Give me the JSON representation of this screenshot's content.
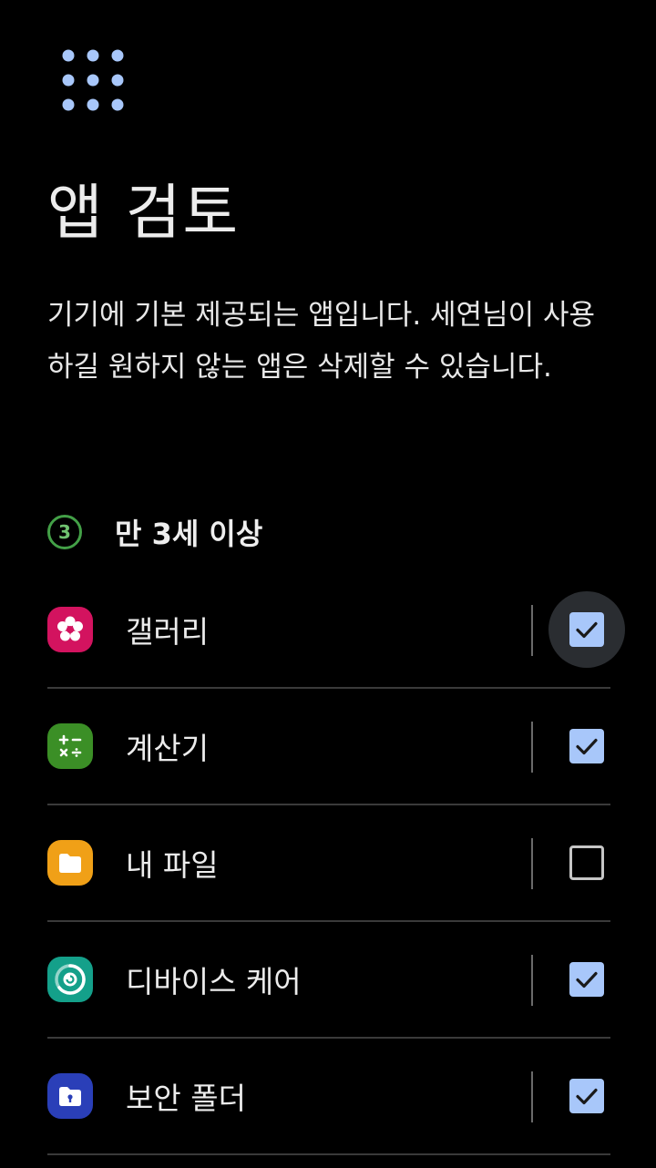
{
  "header": {
    "title": "앱 검토",
    "description": "기기에 기본 제공되는 앱입니다. 세연님이 사용하길 원하지 않는 앱은 삭제할 수 있습니다."
  },
  "age_rating": {
    "badge": "3",
    "label": "만 3세 이상"
  },
  "apps": [
    {
      "name": "갤러리",
      "icon": "gallery-icon",
      "color": "#d3135f",
      "checked": true
    },
    {
      "name": "계산기",
      "icon": "calculator-icon",
      "color": "#3b8f26",
      "checked": true
    },
    {
      "name": "내 파일",
      "icon": "my-files-icon",
      "color": "#f0a017",
      "checked": false
    },
    {
      "name": "디바이스 케어",
      "icon": "device-care-icon",
      "color": "#14a08a",
      "checked": true
    },
    {
      "name": "보안 폴더",
      "icon": "secure-folder-icon",
      "color": "#2a3fb8",
      "checked": true
    }
  ],
  "colors": {
    "accent": "#a8c7fa",
    "background": "#000000",
    "badge": "#43a047"
  }
}
